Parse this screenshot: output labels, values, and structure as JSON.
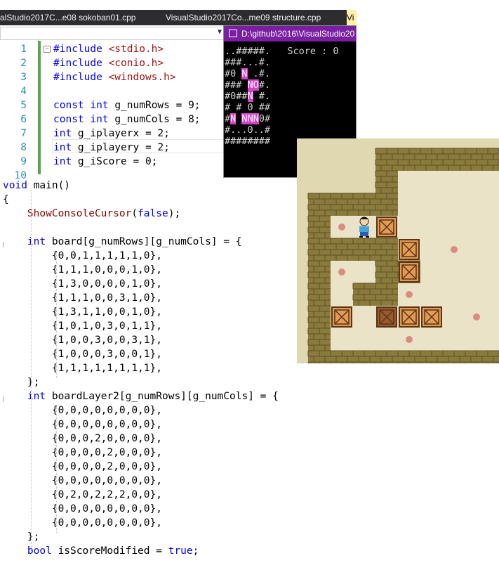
{
  "tabs": [
    {
      "label": "alStudio2017C...e08 sokoban01.cpp"
    },
    {
      "label": "VisualStudio2017Co...me09 structure.cpp"
    },
    {
      "label": "Vi"
    }
  ],
  "editor": {
    "line_numbers": [
      "1",
      "2",
      "3",
      "4",
      "5",
      "6",
      "7",
      "8",
      "9",
      "10"
    ],
    "lines": [
      {
        "text": "#include <stdio.h>"
      },
      {
        "text": "#include <conio.h>"
      },
      {
        "text": "#include <windows.h>"
      },
      {
        "text": ""
      },
      {
        "text": "const int g_numRows = 9;"
      },
      {
        "text": "const int g_numCols = 8;"
      },
      {
        "text": "int g_iplayerx = 2;"
      },
      {
        "text": "int g_iplayery = 2;"
      },
      {
        "text": "int g_iScore = 0;"
      },
      {
        "text": ""
      },
      {
        "text": "void main()"
      },
      {
        "text": "{"
      },
      {
        "text": "    ShowConsoleCursor(false);"
      },
      {
        "text": ""
      },
      {
        "text": "    int board[g_numRows][g_numCols] = {"
      },
      {
        "text": "        {0,0,1,1,1,1,1,0},"
      },
      {
        "text": "        {1,1,1,0,0,0,1,0},"
      },
      {
        "text": "        {1,3,0,0,0,0,1,0},"
      },
      {
        "text": "        {1,1,1,0,0,3,1,0},"
      },
      {
        "text": "        {1,3,1,1,0,0,1,0},"
      },
      {
        "text": "        {1,0,1,0,3,0,1,1},"
      },
      {
        "text": "        {1,0,0,3,0,0,3,1},"
      },
      {
        "text": "        {1,0,0,0,3,0,0,1},"
      },
      {
        "text": "        {1,1,1,1,1,1,1,1},"
      },
      {
        "text": "    };"
      },
      {
        "text": "    int boardLayer2[g_numRows][g_numCols] = {"
      },
      {
        "text": "        {0,0,0,0,0,0,0,0},"
      },
      {
        "text": "        {0,0,0,0,0,0,0,0},"
      },
      {
        "text": "        {0,0,0,2,0,0,0,0},"
      },
      {
        "text": "        {0,0,0,0,2,0,0,0},"
      },
      {
        "text": "        {0,0,0,0,2,0,0,0},"
      },
      {
        "text": "        {0,0,0,0,0,0,0,0},"
      },
      {
        "text": "        {0,2,0,2,2,2,0,0},"
      },
      {
        "text": "        {0,0,0,0,0,0,0,0},"
      },
      {
        "text": "        {0,0,0,0,0,0,0,0},"
      },
      {
        "text": "    };"
      },
      {
        "text": "    bool isScoreModified = true;"
      }
    ]
  },
  "console": {
    "title": "D:\\github\\2016\\VisualStudio20",
    "rows": [
      "..#####.   Score : 0",
      "###...#.",
      "#0 N .#.",
      "### NO#.",
      "#0##N #.",
      "# # 0 ##",
      "#N NNN0#",
      "#...0..#",
      "########"
    ]
  },
  "game": {
    "grid": [
      "...#######.",
      "...#.....#.",
      "####.....#.",
      "#..PX....#.",
      "####..X.P#.",
      "#.P##.X..#.",
      "#.##.....##",
      "#X..XXX.P.#",
      "#.......P.#",
      "###########"
    ],
    "colors": {
      "wall": "#8a7a3c",
      "floor": "#ebe3c7",
      "box": "#e39a55",
      "box_on_goal": "#9a5a2d",
      "goal": "#d98c80",
      "bg": "#e0d8b0"
    }
  }
}
